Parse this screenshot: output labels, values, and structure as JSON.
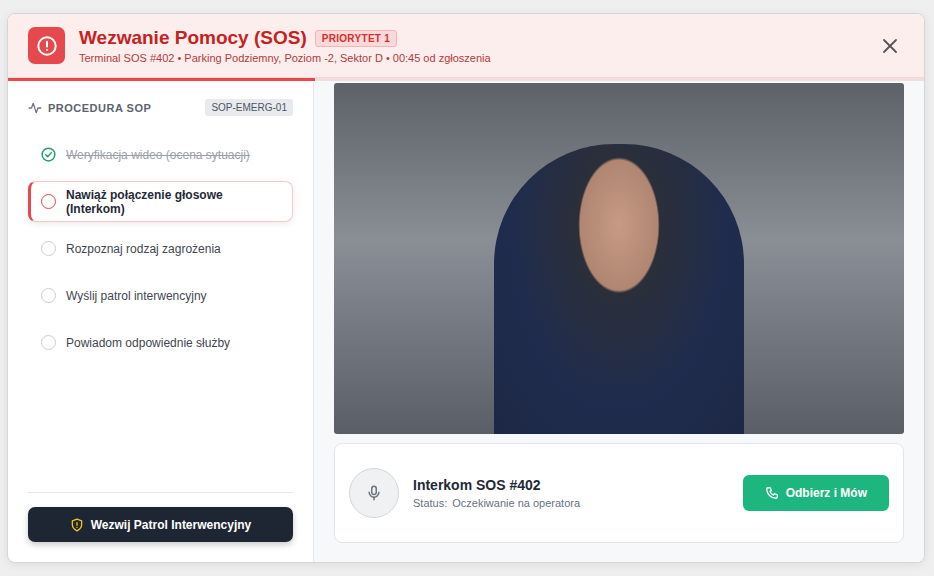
{
  "header": {
    "title": "Wezwanie Pomocy (SOS)",
    "priority": "PRIORYTET 1",
    "subtitle": "Terminal SOS #402 • Parking Podziemny, Poziom -2, Sektor D • 00:45 od zgłoszenia",
    "timer_level": 0.335
  },
  "procedure": {
    "title": "PROCEDURA SOP",
    "code": "SOP-EMERG-01",
    "steps": [
      {
        "label": "Weryfikacja wideo (ocena sytuacji)",
        "done": true,
        "selected": false
      },
      {
        "label": "Nawiąż połączenie głosowe (Interkom)",
        "done": false,
        "selected": true
      },
      {
        "label": "Rozpoznaj rodzaj zagrożenia",
        "done": false,
        "selected": false
      },
      {
        "label": "Wyślij patrol interwencyjny",
        "done": false,
        "selected": false
      },
      {
        "label": "Powiadom odpowiednie służby",
        "done": false,
        "selected": false
      }
    ]
  },
  "patrol_button": "Wezwij Patrol Interwencyjny",
  "intercom": {
    "title": "Interkom SOS #402",
    "status_label": "Status:",
    "status": "Oczekiwanie na operatora",
    "button": "Odbierz i Mów"
  }
}
